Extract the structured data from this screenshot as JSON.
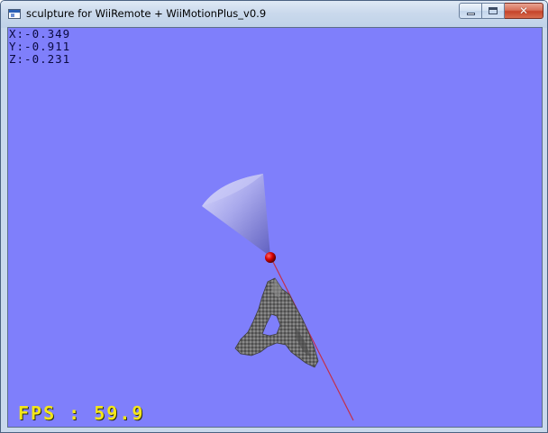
{
  "window": {
    "title": "sculpture for WiiRemote + WiiMotionPlus_v0.9"
  },
  "overlay": {
    "x_text": "X:-0.349",
    "y_text": "Y:-0.911",
    "z_text": "Z:-0.231",
    "fps_text": "FPS : 59.9"
  },
  "colors": {
    "background": "#7f7ffb",
    "fps_text": "#f3e61a",
    "sculpture": "#6a6a6a",
    "pointer_line": "#c2304a",
    "pointer_ball": "#d80000"
  }
}
